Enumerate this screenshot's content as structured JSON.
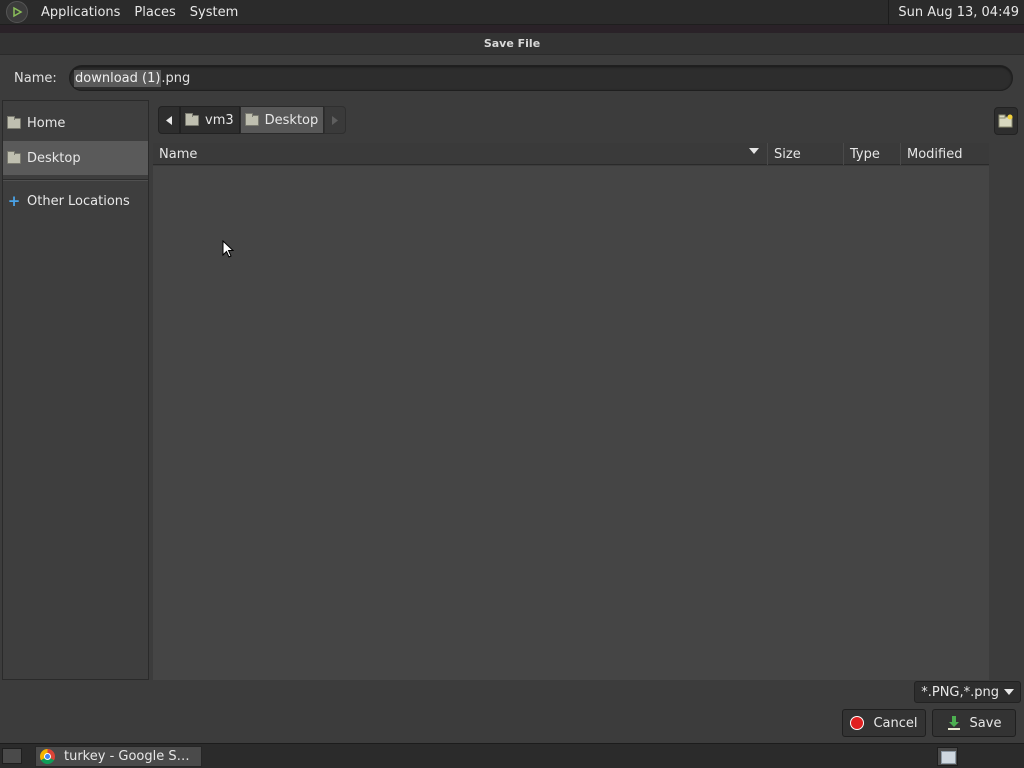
{
  "top_panel": {
    "menus": [
      "Applications",
      "Places",
      "System"
    ],
    "clock": "Sun Aug 13, 04:49"
  },
  "dialog": {
    "title": "Save File",
    "name_label": "Name:",
    "filename_selected": "download (1)",
    "filename_ext": ".png"
  },
  "sidebar": {
    "items": [
      {
        "label": "Home",
        "icon": "home-folder-icon",
        "active": false
      },
      {
        "label": "Desktop",
        "icon": "desktop-folder-icon",
        "active": true
      },
      {
        "label": "Other Locations",
        "icon": "plus-icon",
        "active": false
      }
    ]
  },
  "pathbar": {
    "segments": [
      "vm3",
      "Desktop"
    ]
  },
  "file_list": {
    "columns": [
      "Name",
      "Size",
      "Type",
      "Modified"
    ],
    "rows": []
  },
  "filter": {
    "value": "*.PNG,*.png"
  },
  "buttons": {
    "cancel": "Cancel",
    "save": "Save"
  },
  "taskbar": {
    "items": [
      {
        "label": "turkey - Google Sea…",
        "icon": "chrome-icon"
      }
    ]
  },
  "colors": {
    "panel_bg": "#2b2b2b",
    "dialog_bg": "#3c3c3c",
    "list_bg": "#454545",
    "selection": "#5a5a5a",
    "cancel_red": "#e02020",
    "save_green": "#4caf50"
  }
}
